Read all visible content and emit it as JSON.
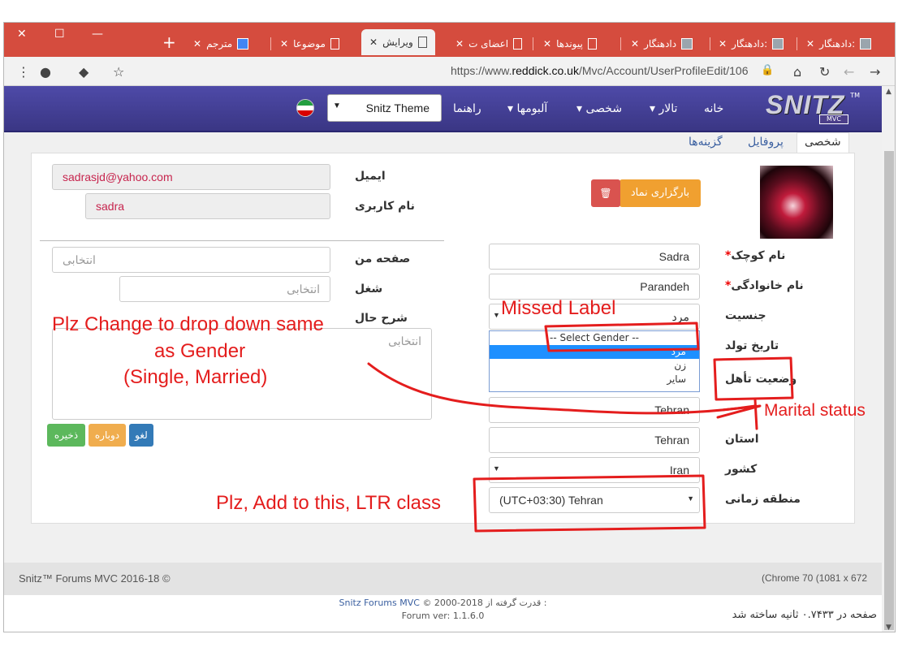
{
  "browser": {
    "window_controls": {
      "close": "✕",
      "maximize": "☐",
      "minimize": "—"
    },
    "new_tab": "+",
    "tabs": [
      {
        "label": "ویرایش",
        "active": true
      },
      {
        "label": "اعضای ت"
      },
      {
        "label": "پیوندها"
      },
      {
        "label": "دادهنگار"
      },
      {
        "label": "دادهنگار:"
      },
      {
        "label": "دادهنگار:"
      },
      {
        "label": "دادهنگار:"
      },
      {
        "label": "موضوعا"
      },
      {
        "label": "مترجم"
      }
    ],
    "url_prefix": "https://www.",
    "url_host": "reddick.co.uk",
    "url_path": "/Mvc/Account/UserProfileEdit/106"
  },
  "nav": {
    "home": "خانه",
    "forums": "تالار",
    "personal": "شخصی",
    "albums": "آلبومها",
    "help": "راهنما",
    "theme": "Snitz Theme",
    "logo": "SNITZ",
    "logo_sub": "MVC",
    "logo_tm": "TM"
  },
  "page_tabs": {
    "personal": "شخصی",
    "profile": "پروفایل",
    "options": "گزینه‌ها"
  },
  "left": {
    "email_label": "ایمیل",
    "email_value": "sadrasjd@yahoo.com",
    "username_label": "نام کاربری",
    "username_value": "sadra",
    "homepage_label": "صفحه من",
    "homepage_placeholder": "انتخابی",
    "job_label": "شغل",
    "job_placeholder": "انتخابی",
    "bio_label": "شرح حال",
    "bio_placeholder": "انتخابی",
    "btn_cancel": "لغو",
    "btn_reset": "دوباره",
    "btn_save": "ذخیره"
  },
  "right": {
    "upload_avatar": "بارگزاری نماد",
    "firstname_label": "نام کوچک",
    "firstname_value": "Sadra",
    "lastname_label": "نام خانوادگی",
    "lastname_value": "Parandeh",
    "gender_label": "جنسیت",
    "gender_value": "مرد",
    "gender_options": [
      "-- Select Gender --",
      "مرد",
      "زن",
      "سایر"
    ],
    "dob_label": "تاریخ تولد",
    "marital_label": "وضعیت تأهل",
    "city_value": "Tehran",
    "province_label": "استان",
    "province_value": "Tehran",
    "country_label": "کشور",
    "country_value": "Iran",
    "timezone_label": "منطقه زمانی",
    "timezone_value": "(UTC+03:30) Tehran",
    "required_mark": "*"
  },
  "footer": {
    "brand": "Snitz™ Forums MVC 2016-18 ©",
    "browser_info": "(Chrome 70 (1081 x 672",
    "copyright_prefix": "قدرت گرفته از :",
    "copyright_link": "Snitz Forums MVC",
    "copyright_years": "© 2000-2018",
    "version": "Forum ver: 1.1.6.0",
    "timing": "صفحه در ۰.۷۴۳۳ ثانیه ساخته شد"
  },
  "annotations": {
    "missed_label": "Missed Label",
    "dropdown_note_1": "Plz Change to drop down same",
    "dropdown_note_2": "as Gender",
    "dropdown_note_3": "(Single, Married)",
    "marital_status": "Marital status",
    "ltr_note": "Plz, Add to this, LTR class"
  },
  "colors": {
    "titlebar": "#d54c3e",
    "navbar": "#3f3b8f",
    "annotation": "#e41d1d",
    "upload_btn": "#f0a030",
    "delete_btn": "#d9534f",
    "cancel_btn": "#337ab7",
    "reset_btn": "#f0ad4e",
    "save_btn": "#5cb85c"
  }
}
